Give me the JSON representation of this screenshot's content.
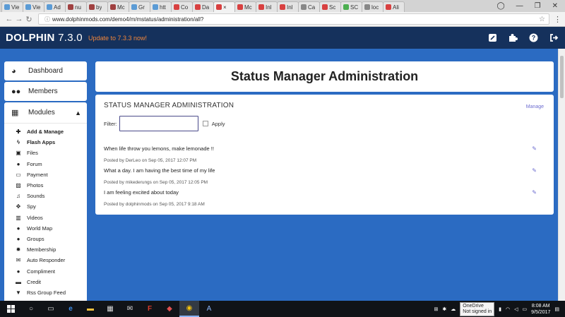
{
  "browser": {
    "tabs": [
      {
        "label": "Vie",
        "color": "#5b9bd5"
      },
      {
        "label": "Vie",
        "color": "#5b9bd5"
      },
      {
        "label": "Ad",
        "color": "#5b9bd5"
      },
      {
        "label": "nu",
        "color": "#a04040"
      },
      {
        "label": "by",
        "color": "#a04040"
      },
      {
        "label": "Mc",
        "color": "#a04040"
      },
      {
        "label": "Gr",
        "color": "#5b9bd5"
      },
      {
        "label": "htt",
        "color": "#5b9bd5"
      },
      {
        "label": "Co",
        "color": "#d84040"
      },
      {
        "label": "Da",
        "color": "#d84040"
      },
      {
        "label": "×",
        "color": "#d84040"
      },
      {
        "label": "Mc",
        "color": "#d84040"
      },
      {
        "label": "Inl",
        "color": "#d84040"
      },
      {
        "label": "Inl",
        "color": "#d84040"
      },
      {
        "label": "Ca",
        "color": "#888888"
      },
      {
        "label": "Sc",
        "color": "#d84040"
      },
      {
        "label": "SC",
        "color": "#4caf50"
      },
      {
        "label": "loc",
        "color": "#888888"
      },
      {
        "label": "Ali",
        "color": "#d84040"
      }
    ],
    "url": "www.dolphinmods.com/demo4/m/mstatus/administration/all?"
  },
  "header": {
    "brand": "DOLPHIN",
    "version": "7.3.0",
    "update_link": "Update to 7.3.3 now!"
  },
  "sidebar": {
    "dashboard": "Dashboard",
    "members": "Members",
    "modules": "Modules",
    "items": [
      {
        "label": "Add & Manage",
        "icon": "plus-icon",
        "glyph": "✚",
        "bold": true
      },
      {
        "label": "Flash Apps",
        "icon": "bolt-icon",
        "glyph": "ϟ",
        "bold": true
      },
      {
        "label": "Files",
        "icon": "save-icon",
        "glyph": "▣"
      },
      {
        "label": "Forum",
        "icon": "comments-icon",
        "glyph": "●"
      },
      {
        "label": "Payment",
        "icon": "credit-card-icon",
        "glyph": "▭"
      },
      {
        "label": "Photos",
        "icon": "picture-icon",
        "glyph": "▨"
      },
      {
        "label": "Sounds",
        "icon": "music-icon",
        "glyph": "♫"
      },
      {
        "label": "Spy",
        "icon": "crosshair-icon",
        "glyph": "✥"
      },
      {
        "label": "Videos",
        "icon": "film-icon",
        "glyph": "▥"
      },
      {
        "label": "World Map",
        "icon": "map-marker-icon",
        "glyph": "●"
      },
      {
        "label": "Groups",
        "icon": "users-icon",
        "glyph": "●"
      },
      {
        "label": "Membership",
        "icon": "certificate-icon",
        "glyph": "✹"
      },
      {
        "label": "Auto Responder",
        "icon": "envelope-icon",
        "glyph": "✉"
      },
      {
        "label": "Compliment",
        "icon": "user-icon",
        "glyph": "●"
      },
      {
        "label": "Credit",
        "icon": "money-icon",
        "glyph": "▬"
      },
      {
        "label": "Rss Group Feed",
        "icon": "filter-icon",
        "glyph": "▼"
      }
    ]
  },
  "page": {
    "title": "Status Manager Administration",
    "section_heading": "STATUS MANAGER ADMINISTRATION",
    "manage_link": "Manage",
    "filter_label": "Filter:",
    "filter_value": "",
    "apply_label": "Apply"
  },
  "posts": [
    {
      "text": "When life throw you lemons, make lemonade !!",
      "meta": "Posted by DerLeo on Sep 05, 2017 12:07 PM"
    },
    {
      "text": "What a day. I am having the best time of my life",
      "meta": "Posted by mikederungs on Sep 05, 2017 12:05 PM"
    },
    {
      "text": "I am feeling excited about today",
      "meta": "Posted by dolphinmods on Sep 05, 2017 9:18 AM"
    }
  ],
  "taskbar": {
    "onedrive_tip_title": "OneDrive",
    "onedrive_tip_status": "Not signed in",
    "time": "8:08 AM",
    "date": "9/5/2017"
  },
  "colors": {
    "header_bg": "#15315c",
    "page_bg": "#2b6bc2",
    "update_link": "#f2863a",
    "link": "#6d6dd0"
  }
}
